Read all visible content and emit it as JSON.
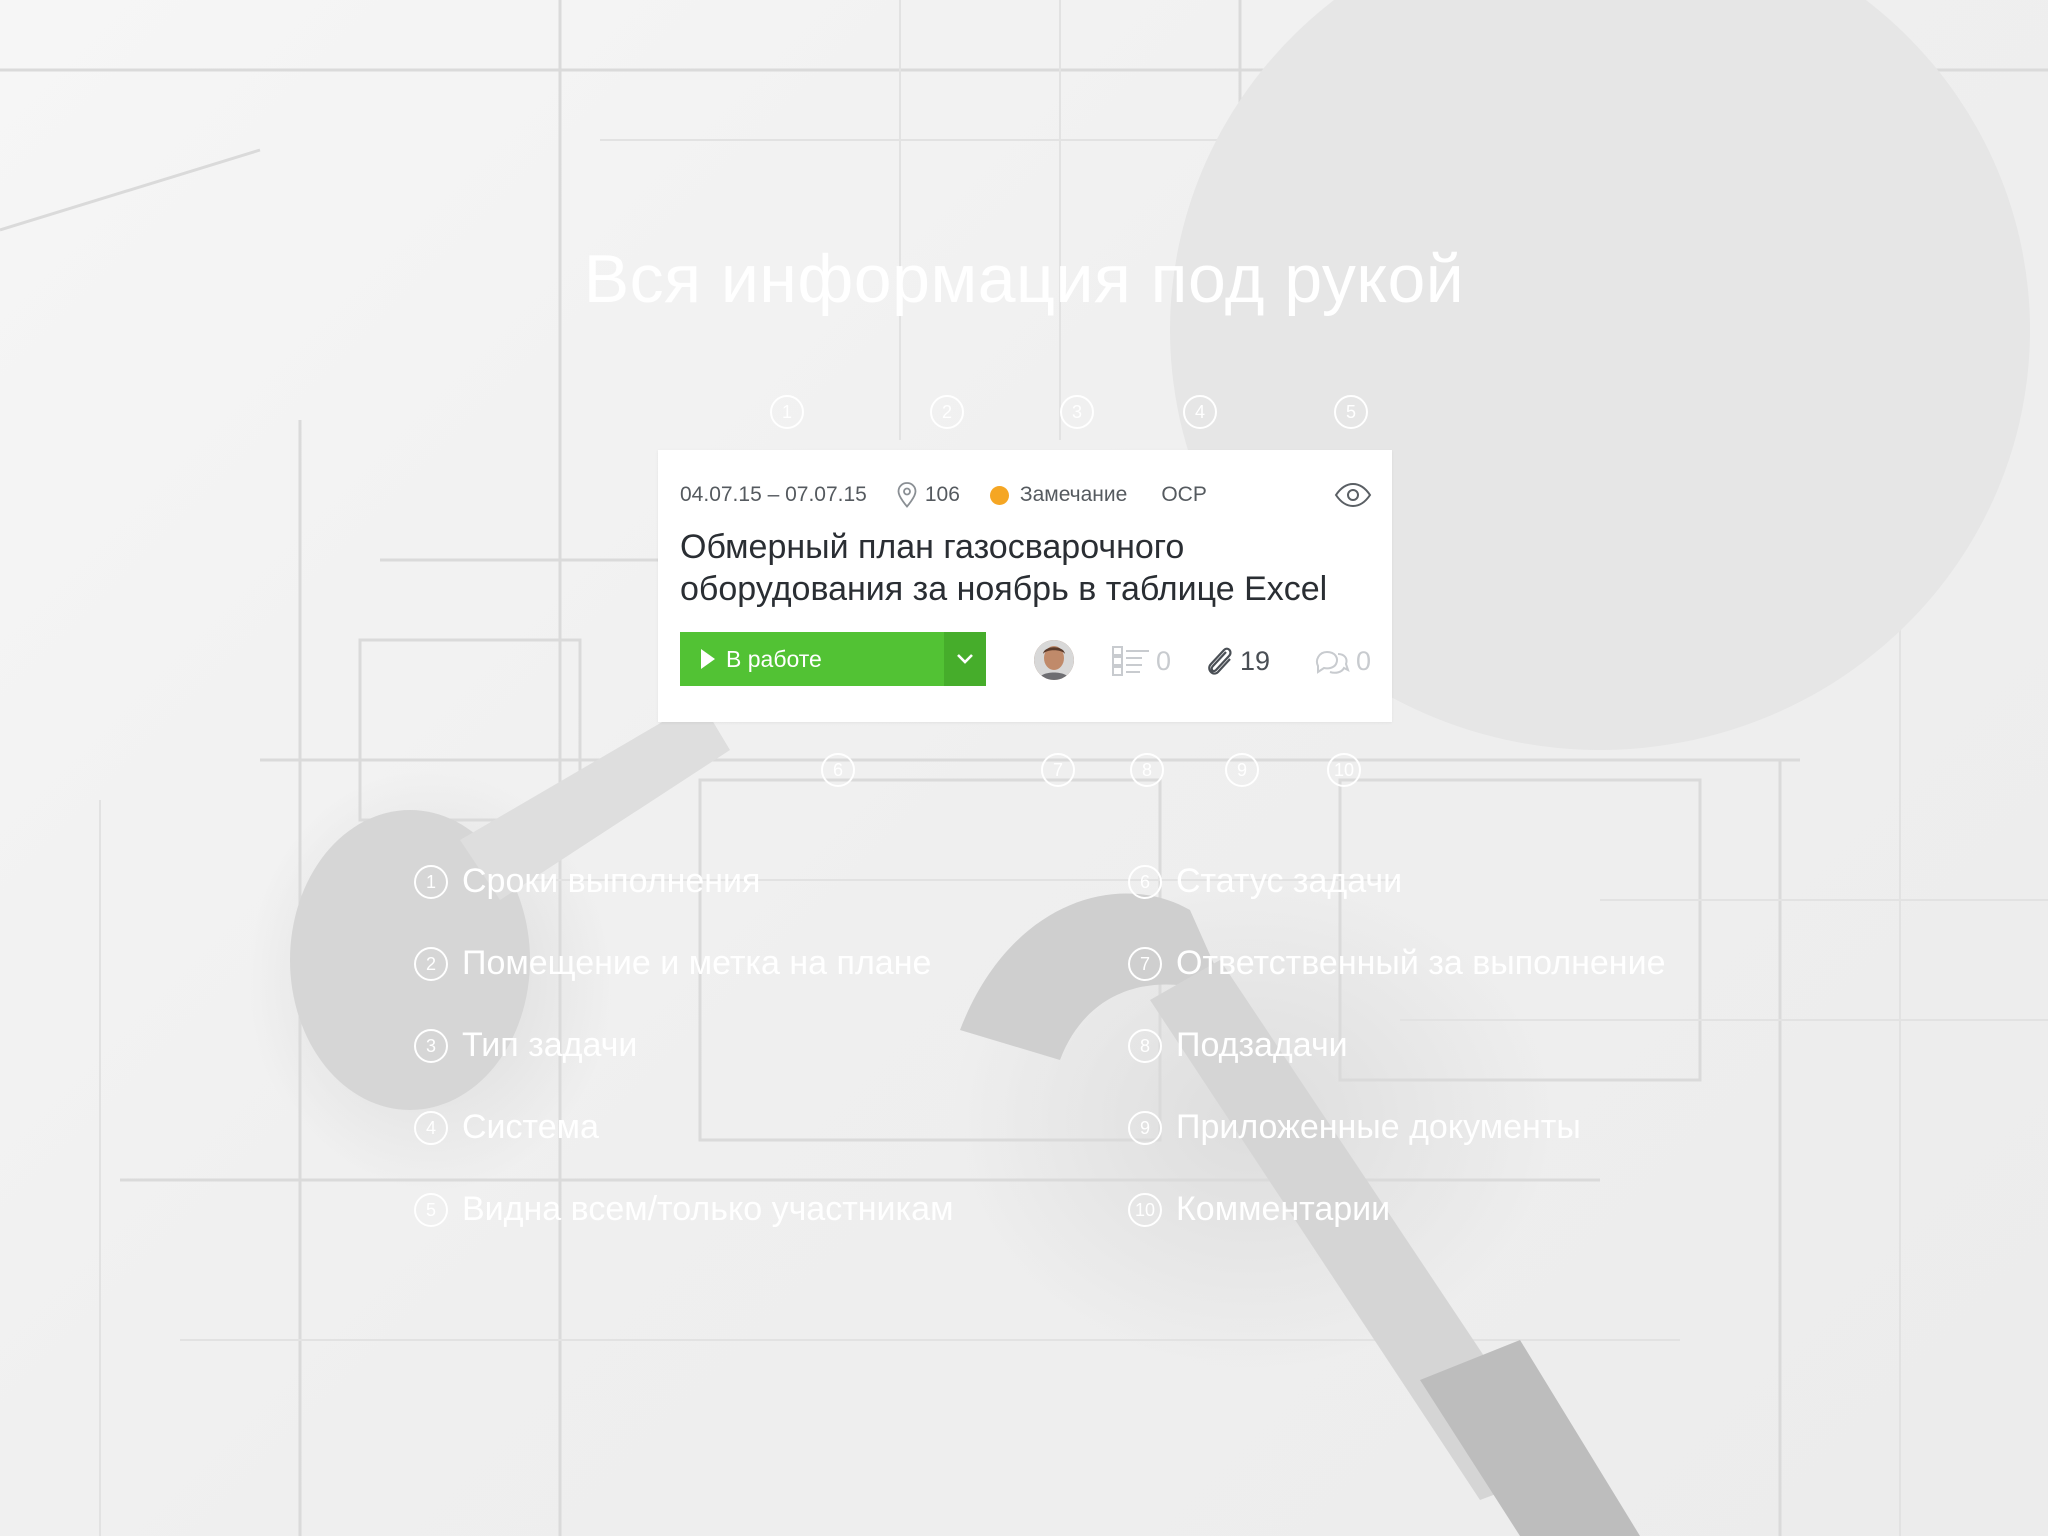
{
  "headline": "Вся информация под рукой",
  "task_card": {
    "dates": "04.07.15 – 07.07.15",
    "room": "106",
    "type": "Замечание",
    "type_color": "#f5a623",
    "system": "ОСР",
    "visibility_icon": "eye-icon",
    "title": "Обмерный план газосварочного оборудования за ноябрь в таблице Excel",
    "status_label": "В работе",
    "status_color": "#52c234",
    "subtasks_count": "0",
    "attachments_count": "19",
    "comments_count": "0"
  },
  "markers": [
    "1",
    "2",
    "3",
    "4",
    "5",
    "6",
    "7",
    "8",
    "9",
    "10"
  ],
  "legend": {
    "left": [
      {
        "num": "1",
        "text": "Сроки выполнения"
      },
      {
        "num": "2",
        "text": "Помещение и метка на плане"
      },
      {
        "num": "3",
        "text": "Тип задачи"
      },
      {
        "num": "4",
        "text": "Система"
      },
      {
        "num": "5",
        "text": "Видна всем/только участникам"
      }
    ],
    "right": [
      {
        "num": "6",
        "text": "Статус задачи"
      },
      {
        "num": "7",
        "text": "Ответственный за выполнение"
      },
      {
        "num": "8",
        "text": "Подзадачи"
      },
      {
        "num": "9",
        "text": "Приложенные документы"
      },
      {
        "num": "10",
        "text": "Комментарии"
      }
    ]
  }
}
